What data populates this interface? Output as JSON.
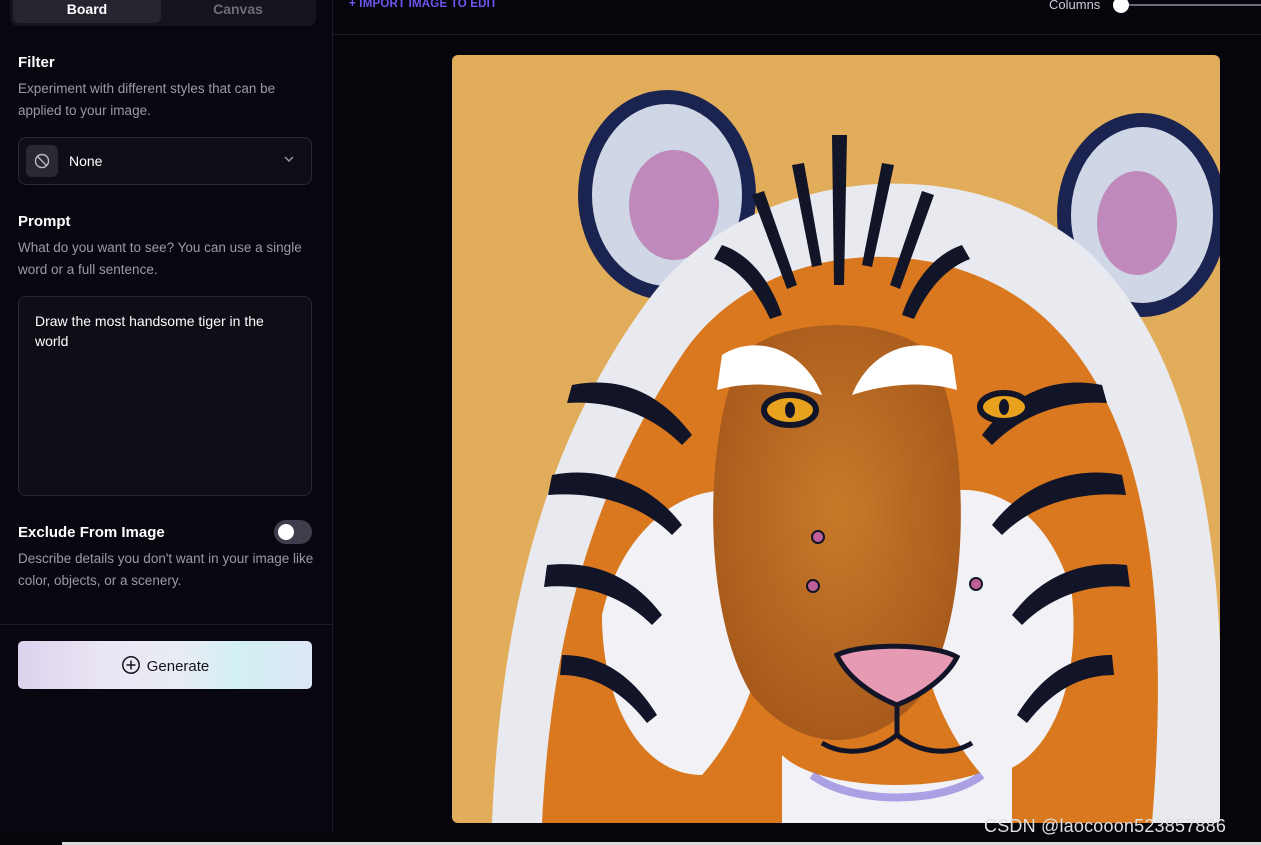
{
  "tabs": {
    "board": "Board",
    "canvas": "Canvas"
  },
  "filter": {
    "heading": "Filter",
    "description": "Experiment with different styles that can be applied to your image.",
    "selected": "None",
    "icon": "ban-icon"
  },
  "prompt": {
    "heading": "Prompt",
    "description": "What do you want to see? You can use a single word or a full sentence.",
    "value": "Draw the most handsome tiger in the world"
  },
  "exclude": {
    "heading": "Exclude From Image",
    "description": "Describe details you don't want in your image like color, objects, or a scenery.",
    "enabled": false
  },
  "generate": {
    "label": "Generate",
    "icon": "plus-circle-icon"
  },
  "toolbar": {
    "import_label": "+ IMPORT IMAGE TO EDIT",
    "columns_label": "Columns",
    "columns_value": 0
  },
  "image": {
    "subject": "tiger",
    "background_color": "#e2ad5a"
  },
  "watermark": "CSDN @laocooon523857886",
  "colors": {
    "accent": "#6c58f0",
    "background": "#06050c",
    "panel": "#0f0e16"
  }
}
